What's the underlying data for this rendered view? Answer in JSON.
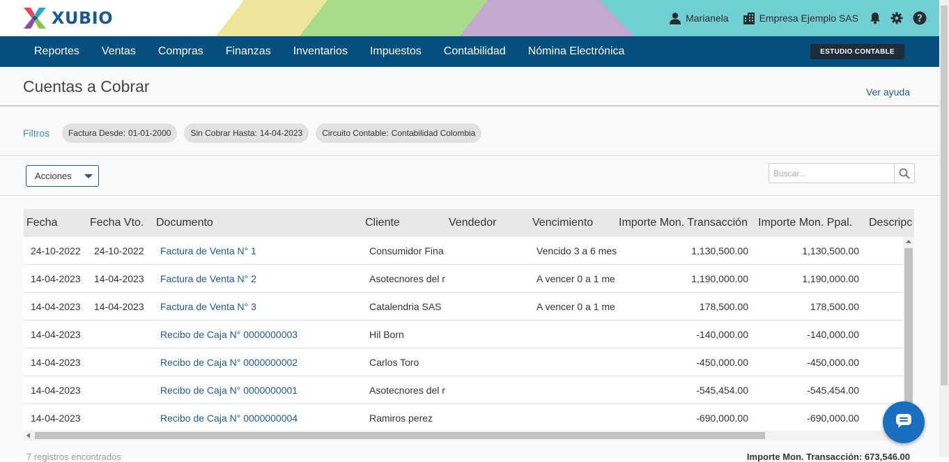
{
  "brand": {
    "name": "XUBIO"
  },
  "user": {
    "name": "Marianela",
    "company": "Empresa Ejemplo SAS"
  },
  "nav": {
    "items": [
      "Reportes",
      "Ventas",
      "Compras",
      "Finanzas",
      "Inventarios",
      "Impuestos",
      "Contabilidad",
      "Nómina Electrónica"
    ],
    "studio_label": "ESTUDIO CONTABLE"
  },
  "page": {
    "title": "Cuentas a Cobrar",
    "help": "Ver ayuda"
  },
  "filters": {
    "label": "Filtros",
    "chips": [
      {
        "key": "Factura Desde:",
        "value": "01-01-2000"
      },
      {
        "key": "Sin Cobrar Hasta:",
        "value": "14-04-2023"
      },
      {
        "key": "Circuito Contable:",
        "value": "Contabilidad Colombia"
      }
    ]
  },
  "toolbar": {
    "actions_label": "Acciones",
    "search_placeholder": "Buscar..."
  },
  "table": {
    "columns": [
      "Fecha",
      "Fecha Vto.",
      "Documento",
      "Cliente",
      "Vendedor",
      "Vencimiento",
      "Importe Mon. Transacción",
      "Importe Mon. Ppal.",
      "Descripc"
    ],
    "rows": [
      {
        "fecha": "24-10-2022",
        "vto": "24-10-2022",
        "documento": "Factura de Venta N° 1",
        "cliente": "Consumidor Fina",
        "vendedor": "",
        "vencimiento": "Vencido 3 a 6 mes",
        "importe_tx": "1,130,500.00",
        "importe_ppal": "1,130,500.00"
      },
      {
        "fecha": "14-04-2023",
        "vto": "14-04-2023",
        "documento": "Factura de Venta N° 2",
        "cliente": "Asotecnores del r",
        "vendedor": "",
        "vencimiento": "A vencer 0 a 1 me",
        "importe_tx": "1,190,000.00",
        "importe_ppal": "1,190,000.00"
      },
      {
        "fecha": "14-04-2023",
        "vto": "14-04-2023",
        "documento": "Factura de Venta N° 3",
        "cliente": "Catalendria SAS",
        "vendedor": "",
        "vencimiento": "A vencer 0 a 1 me",
        "importe_tx": "178,500.00",
        "importe_ppal": "178,500.00"
      },
      {
        "fecha": "14-04-2023",
        "vto": "",
        "documento": "Recibo de Caja N° 0000000003",
        "cliente": "Hil Born",
        "vendedor": "",
        "vencimiento": "",
        "importe_tx": "-140,000.00",
        "importe_ppal": "-140,000.00"
      },
      {
        "fecha": "14-04-2023",
        "vto": "",
        "documento": "Recibo de Caja N° 0000000002",
        "cliente": "Carlos Toro",
        "vendedor": "",
        "vencimiento": "",
        "importe_tx": "-450,000.00",
        "importe_ppal": "-450,000.00"
      },
      {
        "fecha": "14-04-2023",
        "vto": "",
        "documento": "Recibo de Caja N° 0000000001",
        "cliente": "Asotecnores del r",
        "vendedor": "",
        "vencimiento": "",
        "importe_tx": "-545,454.00",
        "importe_ppal": "-545,454.00"
      },
      {
        "fecha": "14-04-2023",
        "vto": "",
        "documento": "Recibo de Caja N° 0000000004",
        "cliente": "Ramiros perez",
        "vendedor": "",
        "vencimiento": "",
        "importe_tx": "-690,000.00",
        "importe_ppal": "-690,000.00"
      }
    ]
  },
  "footer": {
    "records": "7 registros encontrados",
    "total": "Importe Mon. Transacción: 673,546.00"
  },
  "colors": {
    "nav_bg": "#044f7d",
    "link": "#1a5b8f",
    "filter_label": "#3b8fc7",
    "chat": "#1a6fc1"
  }
}
